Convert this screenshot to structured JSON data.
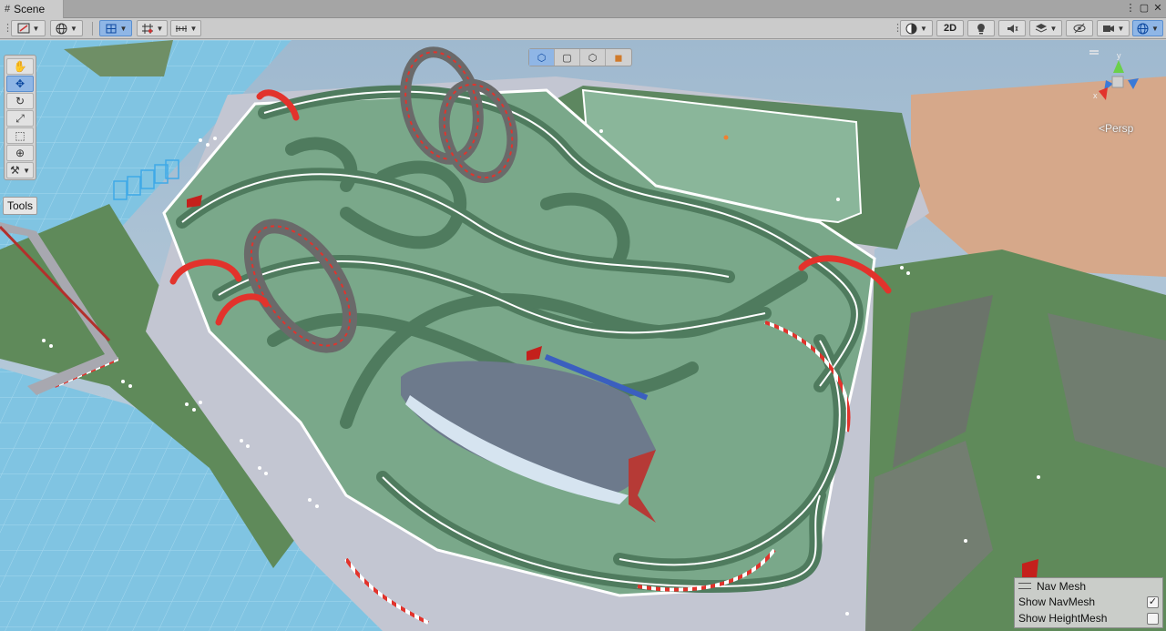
{
  "window": {
    "tab_label": "Scene",
    "tab_icon": "grid-hash-icon",
    "controls": [
      "⋮",
      "▢",
      "✕"
    ]
  },
  "toolbar": {
    "left": [
      {
        "name": "draw-mode-button",
        "icon": "shaded-mode-icon"
      },
      {
        "name": "global-local-button",
        "icon": "globe-icon"
      },
      {
        "name": "move-snap-button",
        "icon": "grid-snap-icon",
        "active": true
      },
      {
        "name": "grid-snap-button",
        "icon": "grid-icon"
      },
      {
        "name": "increment-snap-button",
        "icon": "ruler-icon"
      }
    ],
    "right": [
      {
        "name": "shading-mode-button",
        "icon": "sphere-icon"
      },
      {
        "name": "2d-toggle",
        "label": "2D"
      },
      {
        "name": "lighting-toggle",
        "icon": "lightbulb-icon"
      },
      {
        "name": "audio-toggle",
        "icon": "speaker-icon"
      },
      {
        "name": "effects-button",
        "icon": "layers-icon"
      },
      {
        "name": "hidden-objects-toggle",
        "icon": "eye-slash-icon"
      },
      {
        "name": "camera-settings-button",
        "icon": "camera-icon"
      },
      {
        "name": "gizmos-button",
        "icon": "gizmo-globe-icon",
        "active": true
      }
    ],
    "label_2d": "2D"
  },
  "tools_panel": {
    "tools": [
      {
        "name": "view-tool",
        "icon": "hand-icon"
      },
      {
        "name": "move-tool",
        "icon": "move-arrows-icon",
        "active": true
      },
      {
        "name": "rotate-tool",
        "icon": "rotate-icon"
      },
      {
        "name": "scale-tool",
        "icon": "scale-icon"
      },
      {
        "name": "rect-tool",
        "icon": "rect-icon"
      },
      {
        "name": "transform-tool",
        "icon": "transform-icon"
      },
      {
        "name": "custom-tool",
        "icon": "wrench-icon"
      }
    ],
    "label": "Tools"
  },
  "view_orientation": [
    "cube-iso",
    "cube-rect",
    "cube-wire",
    "cube-orange"
  ],
  "gizmo": {
    "y_label": "y",
    "x_label": "x",
    "persp_label": "<Persp"
  },
  "navmesh_overlay": {
    "title": "Nav Mesh",
    "show_navmesh_label": "Show NavMesh",
    "show_navmesh_checked": true,
    "show_heightmesh_label": "Show HeightMesh",
    "show_heightmesh_checked": false
  },
  "colors": {
    "sky": "#a9c4d8",
    "water": "#7fc3e3",
    "ground": "#c3c6d2",
    "navmesh": "#7aa88a",
    "track_dark": "#4f7b5e",
    "grass": "#5f8a5a",
    "rock": "#7f7f7f",
    "kerb_red": "#e2332c",
    "accent_blue": "#5a8fd0"
  }
}
